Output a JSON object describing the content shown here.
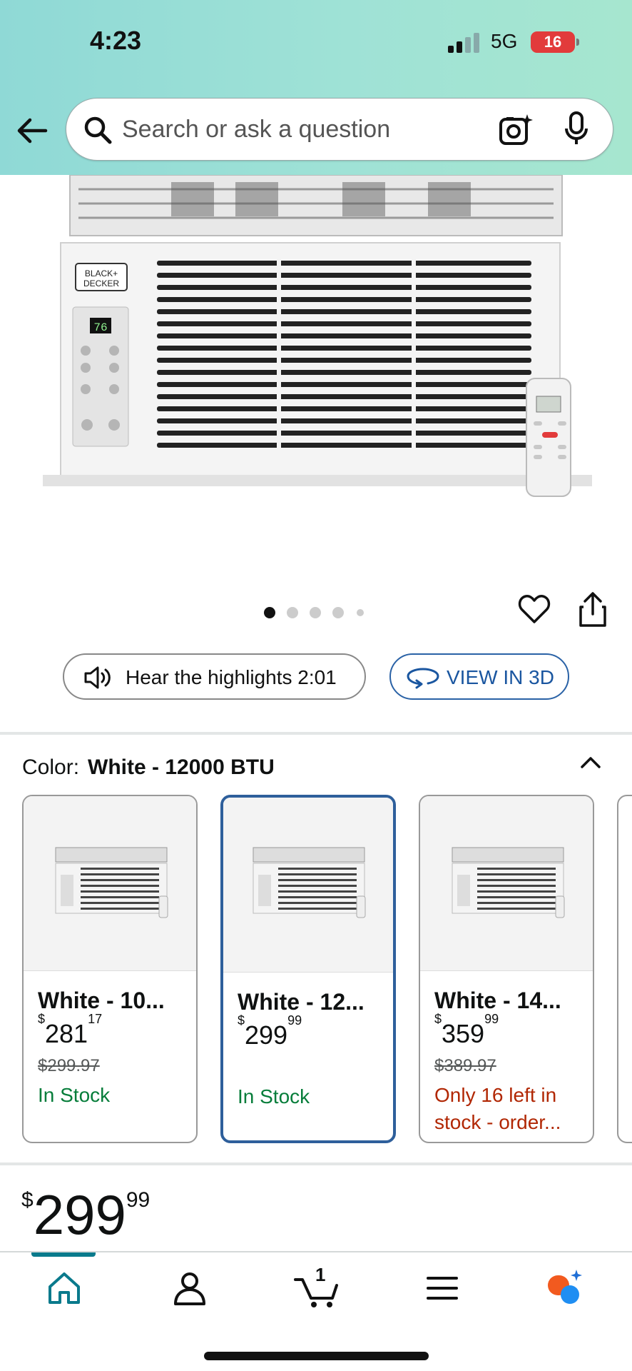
{
  "status_bar": {
    "time": "4:23",
    "network": "5G",
    "battery": "16"
  },
  "search": {
    "placeholder": "Search or ask a question"
  },
  "gallery": {
    "dot_count": 5,
    "active_index": 0
  },
  "actions": {
    "hear_label": "Hear the highlights 2:01",
    "view3d_label": "VIEW IN 3D"
  },
  "color": {
    "label": "Color:",
    "value": "White - 12000 BTU"
  },
  "variants": [
    {
      "name": "White - 10...",
      "price_whole": "281",
      "price_cents": "17",
      "currency": "$",
      "list_price": "$299.97",
      "stock": "In Stock",
      "stock_status": "in",
      "selected": false
    },
    {
      "name": "White - 12...",
      "price_whole": "299",
      "price_cents": "99",
      "currency": "$",
      "list_price": "",
      "stock": "In Stock",
      "stock_status": "in",
      "selected": true
    },
    {
      "name": "White - 14...",
      "price_whole": "359",
      "price_cents": "99",
      "currency": "$",
      "list_price": "$389.97",
      "stock": "Only 16 left in stock - order...",
      "stock_status": "low",
      "selected": false
    }
  ],
  "price": {
    "currency": "$",
    "whole": "299",
    "cents": "99"
  },
  "cart": {
    "count": "1"
  },
  "brand_text": "BLACK+ DECKER",
  "colors": {
    "accent": "#2e5f9b",
    "in_stock": "#067d3a",
    "low_stock": "#b12704",
    "nav_active": "#0a7a8c"
  }
}
